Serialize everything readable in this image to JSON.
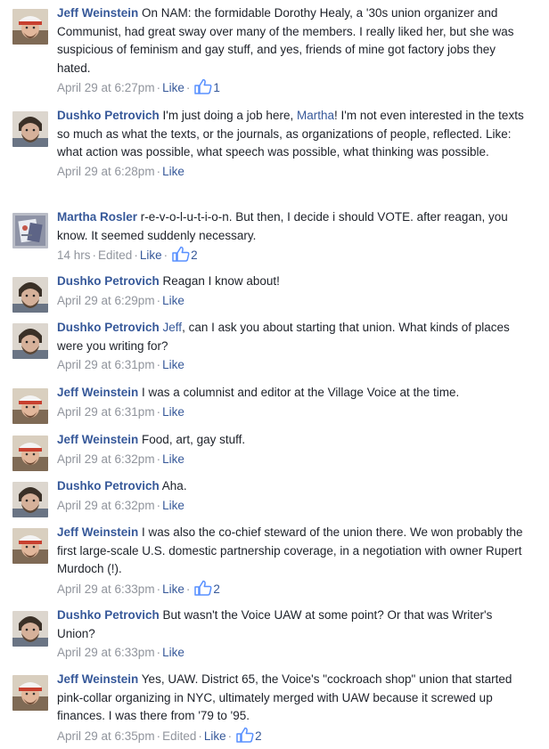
{
  "comments": [
    {
      "author": "Jeff Weinstein",
      "avatar": "jeff",
      "segments": [
        {
          "text": "On NAM: the formidable Dorothy Healy, a '30s union organizer and Communist, had great sway over many of the members. I really liked her, but she was suspicious of feminism and gay stuff, and yes, friends of mine got factory jobs they hated."
        }
      ],
      "timestamp": "April 29 at 6:27pm",
      "edited": null,
      "like_label": "Like",
      "likes": "1"
    },
    {
      "author": "Dushko Petrovich",
      "avatar": "dushko",
      "segments": [
        {
          "text": "I'm just doing a job here, "
        },
        {
          "text": "Martha",
          "mention": true
        },
        {
          "text": "! I'm not even interested in the texts so much as what the texts, or the journals, as organizations of people, reflected. Like: what action was possible, what speech was possible, what thinking was possible."
        }
      ],
      "timestamp": "April 29 at 6:28pm",
      "edited": null,
      "like_label": "Like",
      "likes": null
    },
    {
      "author": "Martha Rosler",
      "avatar": "martha",
      "segments": [
        {
          "text": "r-e-v-o-l-u-t-i-o-n. But then, I decide i should VOTE. after reagan, you know. It seemed suddenly necessary."
        }
      ],
      "timestamp": "14 hrs",
      "edited": "Edited",
      "like_label": "Like",
      "likes": "2"
    },
    {
      "author": "Dushko Petrovich",
      "avatar": "dushko",
      "segments": [
        {
          "text": "Reagan I know about!"
        }
      ],
      "timestamp": "April 29 at 6:29pm",
      "edited": null,
      "like_label": "Like",
      "likes": null
    },
    {
      "author": "Dushko Petrovich",
      "avatar": "dushko",
      "segments": [
        {
          "text": "Jeff",
          "mention": true
        },
        {
          "text": ", can I ask you about starting that union. What kinds of places were you writing for?"
        }
      ],
      "timestamp": "April 29 at 6:31pm",
      "edited": null,
      "like_label": "Like",
      "likes": null
    },
    {
      "author": "Jeff Weinstein",
      "avatar": "jeff",
      "segments": [
        {
          "text": "I was a columnist and editor at the Village Voice at the time."
        }
      ],
      "timestamp": "April 29 at 6:31pm",
      "edited": null,
      "like_label": "Like",
      "likes": null
    },
    {
      "author": "Jeff Weinstein",
      "avatar": "jeff",
      "segments": [
        {
          "text": "Food, art, gay stuff."
        }
      ],
      "timestamp": "April 29 at 6:32pm",
      "edited": null,
      "like_label": "Like",
      "likes": null
    },
    {
      "author": "Dushko Petrovich",
      "avatar": "dushko",
      "segments": [
        {
          "text": "Aha."
        }
      ],
      "timestamp": "April 29 at 6:32pm",
      "edited": null,
      "like_label": "Like",
      "likes": null
    },
    {
      "author": "Jeff Weinstein",
      "avatar": "jeff",
      "segments": [
        {
          "text": "I was also the co-chief steward of the union there. We won probably the first large-scale U.S. domestic partnership coverage, in a negotiation with owner Rupert Murdoch (!)."
        }
      ],
      "timestamp": "April 29 at 6:33pm",
      "edited": null,
      "like_label": "Like",
      "likes": "2"
    },
    {
      "author": "Dushko Petrovich",
      "avatar": "dushko",
      "segments": [
        {
          "text": "But wasn't the Voice UAW at some point? Or that was Writer's Union?"
        }
      ],
      "timestamp": "April 29 at 6:33pm",
      "edited": null,
      "like_label": "Like",
      "likes": null
    },
    {
      "author": "Jeff Weinstein",
      "avatar": "jeff",
      "segments": [
        {
          "text": "Yes, UAW. District 65, the Voice's \"cockroach shop\" union that started pink-collar organizing in NYC, ultimately merged with UAW because it screwed up finances. I was there from '79 to '95."
        }
      ],
      "timestamp": "April 29 at 6:35pm",
      "edited": "Edited",
      "like_label": "Like",
      "likes": "2"
    }
  ],
  "separator": "·",
  "colors": {
    "author": "#365899",
    "meta": "#90949c",
    "text": "#1d2129"
  },
  "icons": {
    "like": "thumbs-up-icon"
  }
}
